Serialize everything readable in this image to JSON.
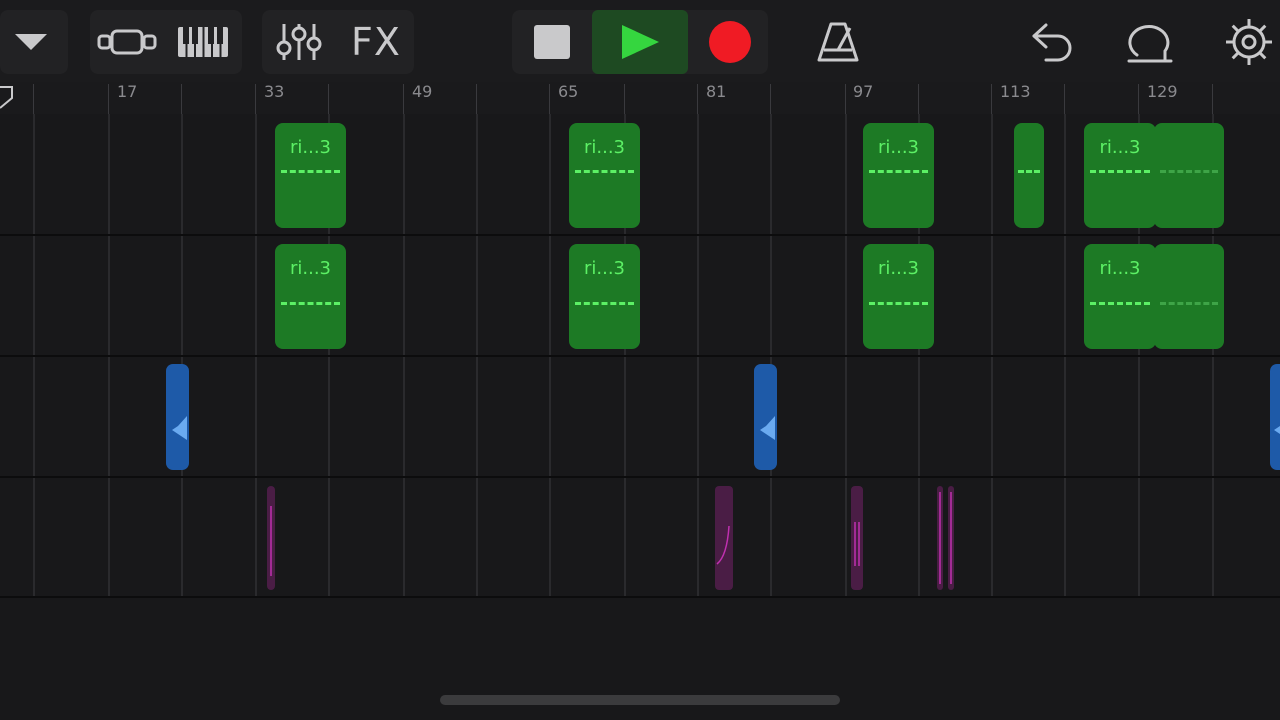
{
  "toolbar": {
    "tracks_dropdown_icon": "chevron-down-icon",
    "view_icon": "tracks-view-icon",
    "keyboard_icon": "piano-keys-icon",
    "mixer_icon": "mixer-sliders-icon",
    "fx_label": "FX",
    "stop_icon": "stop-icon",
    "play_icon": "play-icon",
    "record_icon": "record-icon",
    "metronome_icon": "metronome-icon",
    "undo_icon": "undo-icon",
    "loop_icon": "loop-browser-icon",
    "settings_icon": "gear-icon",
    "colors": {
      "play": "#35d63f",
      "record": "#f01b24",
      "stop": "#c9c9cb"
    }
  },
  "ruler": {
    "markers": [
      "17",
      "33",
      "49",
      "65",
      "81",
      "97",
      "113",
      "129"
    ]
  },
  "tracks": [
    {
      "name": "midi-track-1",
      "color": "#1d7a25",
      "regions": [
        {
          "label": "ri...3"
        },
        {
          "label": "ri...3"
        },
        {
          "label": "ri...3"
        },
        {
          "label": ""
        },
        {
          "label": "ri...3"
        },
        {
          "label": ""
        }
      ]
    },
    {
      "name": "midi-track-2",
      "color": "#1d7a25",
      "regions": [
        {
          "label": "ri...3"
        },
        {
          "label": "ri...3"
        },
        {
          "label": "ri...3"
        },
        {
          "label": "ri...3"
        },
        {
          "label": ""
        }
      ]
    },
    {
      "name": "audio-track",
      "color": "#1e5aa8"
    },
    {
      "name": "fx-track",
      "color": "#c030b0"
    }
  ]
}
